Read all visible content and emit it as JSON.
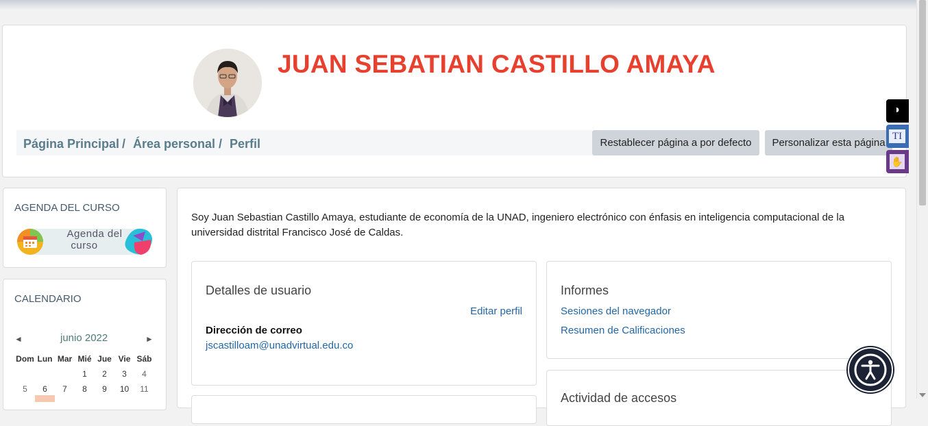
{
  "profile": {
    "name": "JUAN SEBATIAN CASTILLO AMAYA",
    "bio": "Soy Juan Sebastian Castillo Amaya, estudiante de economía de la UNAD, ingeniero electrónico con énfasis en inteligencia computacional de la universidad distrital Francisco José de Caldas."
  },
  "breadcrumb": {
    "home": "Página Principal",
    "sep": "/",
    "dashboard": "Área personal",
    "current": "Perfil"
  },
  "buttons": {
    "reset": "Restablecer página a por defecto",
    "customize": "Personalizar esta página"
  },
  "agenda": {
    "title": "AGENDA DEL CURSO",
    "badge_line1": "Agenda del",
    "badge_line2": "curso"
  },
  "calendar": {
    "title": "CALENDARIO",
    "prev": "◄",
    "next": "►",
    "month": "junio 2022",
    "days": [
      "Dom",
      "Lun",
      "Mar",
      "Mié",
      "Jue",
      "Vie",
      "Sáb"
    ],
    "week1": [
      "",
      "",
      "",
      "1",
      "2",
      "3",
      "4"
    ],
    "week2": [
      "5",
      "6",
      "7",
      "8",
      "9",
      "10",
      "11"
    ]
  },
  "user_details": {
    "title": "Detalles de usuario",
    "edit": "Editar perfil",
    "email_label": "Dirección de correo",
    "email": "jscastilloam@unadvirtual.edu.co"
  },
  "reports": {
    "title": "Informes",
    "sessions": "Sesiones del navegador",
    "grades": "Resumen de Calificaciones"
  },
  "access": {
    "title": "Actividad de accesos"
  },
  "side_tools": {
    "contrast": "◑",
    "text": "TI",
    "sign": "✋"
  },
  "colors": {
    "name": "#e8402e",
    "crumb": "#5a7d8c",
    "link": "#2367a6"
  }
}
